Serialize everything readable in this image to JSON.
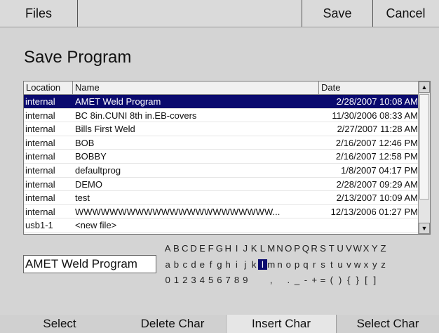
{
  "topbar": {
    "files_label": "Files",
    "save_label": "Save",
    "cancel_label": "Cancel"
  },
  "page_title": "Save Program",
  "table": {
    "headers": {
      "location": "Location",
      "name": "Name",
      "date": "Date"
    },
    "rows": [
      {
        "location": "internal",
        "name": "AMET Weld Program",
        "date": "2/28/2007 10:08 AM",
        "selected": true
      },
      {
        "location": "internal",
        "name": "BC 8in.CUNI 8th in.EB-covers",
        "date": "11/30/2006 08:33 AM"
      },
      {
        "location": "internal",
        "name": "Bills First Weld",
        "date": "2/27/2007 11:28 AM"
      },
      {
        "location": "internal",
        "name": "BOB",
        "date": "2/16/2007 12:46 PM"
      },
      {
        "location": "internal",
        "name": "BOBBY",
        "date": "2/16/2007 12:58 PM"
      },
      {
        "location": "internal",
        "name": "defaultprog",
        "date": "1/8/2007 04:17 PM"
      },
      {
        "location": "internal",
        "name": "DEMO",
        "date": "2/28/2007 09:29 AM"
      },
      {
        "location": "internal",
        "name": "test",
        "date": "2/13/2007 10:09 AM"
      },
      {
        "location": "internal",
        "name": "WWWWWWWWWWWWWWWWWWWWWWW...",
        "date": "12/13/2006 01:27 PM"
      },
      {
        "location": "usb1-1",
        "name": "<new file>",
        "date": ""
      }
    ]
  },
  "filename_value": "AMET Weld Program",
  "keyboard": {
    "uppercase": [
      "A",
      "B",
      "C",
      "D",
      "E",
      "F",
      "G",
      "H",
      "I",
      "J",
      "K",
      "L",
      "M",
      "N",
      "O",
      "P",
      "Q",
      "R",
      "S",
      "T",
      "U",
      "V",
      "W",
      "X",
      "Y",
      "Z"
    ],
    "lowercase": [
      "a",
      "b",
      "c",
      "d",
      "e",
      "f",
      "g",
      "h",
      "i",
      "j",
      "k",
      "l",
      "m",
      "n",
      "o",
      "p",
      "q",
      "r",
      "s",
      "t",
      "u",
      "v",
      "w",
      "x",
      "y",
      "z"
    ],
    "symbols": [
      "0",
      "1",
      "2",
      "3",
      "4",
      "5",
      "6",
      "7",
      "8",
      "9",
      " ",
      " ",
      ",",
      " ",
      ".",
      "_",
      "-",
      "+",
      "=",
      "(",
      ")",
      "{",
      "}",
      "[",
      "]"
    ],
    "highlighted_key": "l"
  },
  "bottombar": {
    "select_label": "Select",
    "delete_char_label": "Delete Char",
    "insert_char_label": "Insert Char",
    "select_char_label": "Select Char"
  },
  "colors": {
    "selection": "#0a0a6e",
    "background": "#d4d4d4"
  }
}
